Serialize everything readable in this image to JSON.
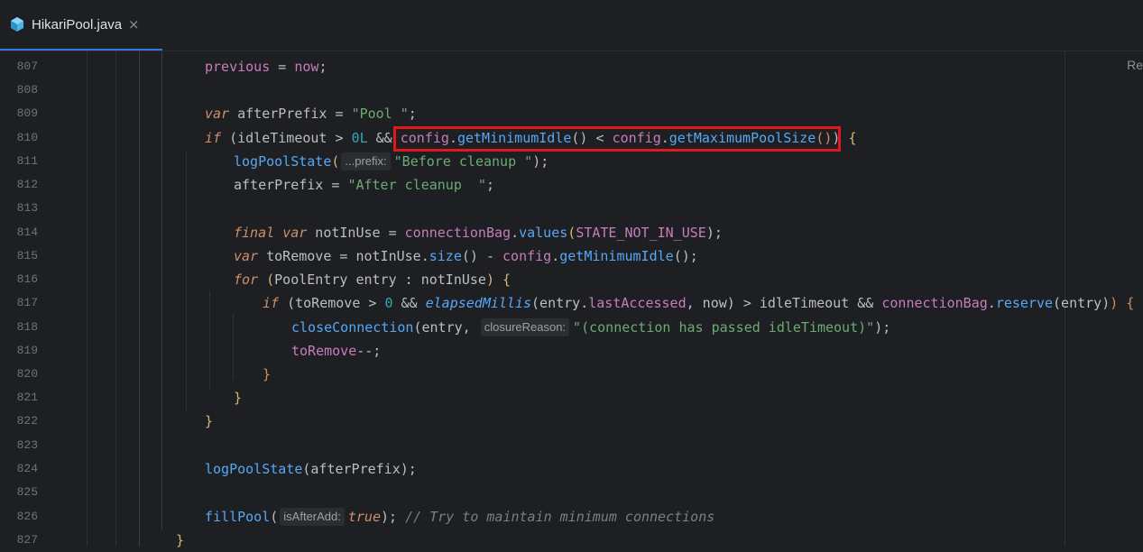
{
  "tab": {
    "filename": "HikariPool.java",
    "close_glyph": "×",
    "icon": "java-file-icon"
  },
  "reader_mode_label": "Re",
  "line_numbers": [
    "807",
    "808",
    "809",
    "810",
    "811",
    "812",
    "813",
    "814",
    "815",
    "816",
    "817",
    "818",
    "819",
    "820",
    "821",
    "822",
    "823",
    "824",
    "825",
    "826",
    "827"
  ],
  "code": {
    "l807": {
      "a": "previous",
      "b": " = ",
      "c": "now",
      "d": ";"
    },
    "l809": {
      "kw": "var",
      "rest": " afterPrefix = ",
      "str": "\"Pool \"",
      "end": ";"
    },
    "l810": {
      "kw": "if",
      "p1": " (idleTimeout > ",
      "num": "0L",
      "p2": " && ",
      "f1": "config",
      "dot1": ".",
      "m1": "getMinimumIdle",
      "p3": "() < ",
      "f2": "config",
      "dot2": ".",
      "m2": "getMaximumPoolSize",
      "p4": "()",
      "p5": ")",
      "p6": " {"
    },
    "l811": {
      "fn": "logPoolState",
      "open": "(",
      "hint": "...prefix:",
      "str": "\"Before cleanup \"",
      "end": ");"
    },
    "l812": {
      "rest": "afterPrefix = ",
      "str": "\"After cleanup  \"",
      "end": ";"
    },
    "l814": {
      "kw1": "final",
      "kw2": "var",
      "rest": " notInUse = ",
      "f": "connectionBag",
      "dot": ".",
      "m": "values",
      "open": "(",
      "c": "STATE_NOT_IN_USE",
      "end": ");"
    },
    "l815": {
      "kw": "var",
      "rest": " toRemove = notInUse.",
      "m1": "size",
      "p1": "() - ",
      "f": "config",
      "dot": ".",
      "m2": "getMinimumIdle",
      "end": "();"
    },
    "l816": {
      "kw": "for",
      "p1": " (",
      "t": "PoolEntry",
      "p2": " entry : notInUse",
      "p3": ")",
      "p4": " {"
    },
    "l817": {
      "kw": "if",
      "p1": " (toRemove > ",
      "num": "0",
      "p2": " && ",
      "m1": "elapsedMillis",
      "p3": "(entry.",
      "f1": "lastAccessed",
      "p4": ", now) > idleTimeout && ",
      "f2": "connectionBag",
      "dot": ".",
      "m2": "reserve",
      "p5": "(entry)",
      "p6": ")",
      "p7": " {"
    },
    "l818": {
      "fn": "closeConnection",
      "open": "(entry, ",
      "hint": "closureReason:",
      "str": "\"(connection has passed idleTimeout)\"",
      "end": ");"
    },
    "l819": {
      "rest": "toRemove",
      "end": "--;"
    },
    "l820": {
      "brace": "}"
    },
    "l821": {
      "brace": "}"
    },
    "l822": {
      "brace": "}"
    },
    "l824": {
      "fn": "logPoolState",
      "rest": "(afterPrefix);"
    },
    "l826": {
      "fn": "fillPool",
      "open": "(",
      "hint": "isAfterAdd:",
      "kw": "true",
      "end": "); ",
      "cmt": "// Try to maintain minimum connections"
    },
    "l827": {
      "brace": "}"
    }
  }
}
